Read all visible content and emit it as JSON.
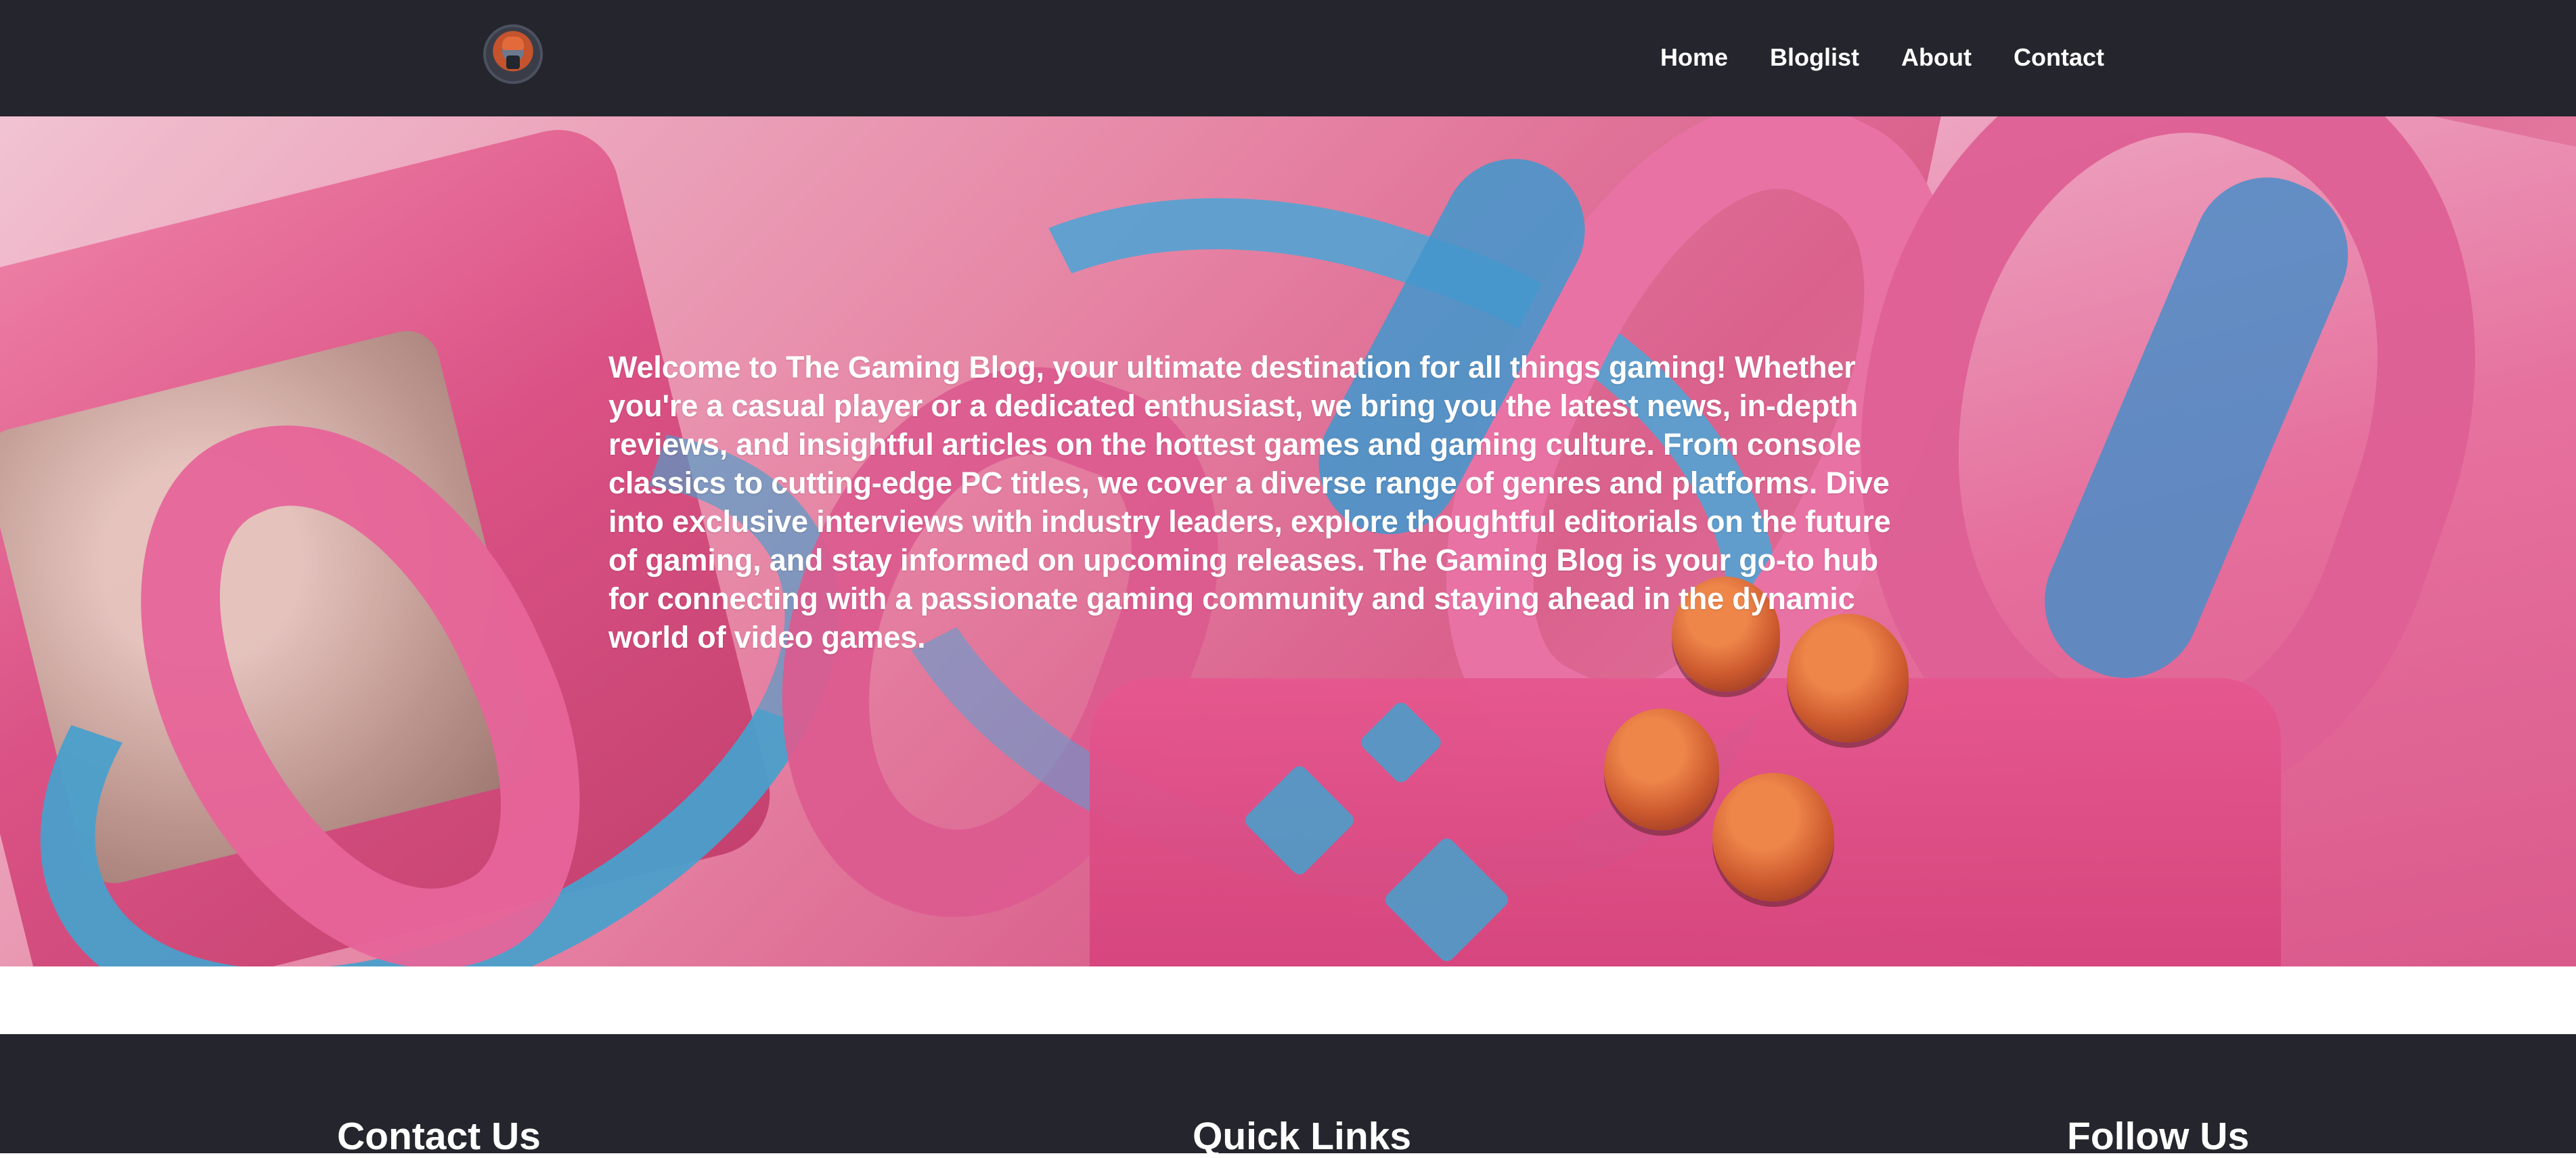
{
  "header": {
    "logo_icon": "gaming-mascot-logo-icon",
    "nav_items": [
      {
        "label": "Home"
      },
      {
        "label": "Bloglist"
      },
      {
        "label": "About"
      },
      {
        "label": "Contact"
      }
    ]
  },
  "hero": {
    "description": "Welcome to The Gaming Blog, your ultimate destination for all things gaming! Whether you're a casual player or a dedicated enthusiast, we bring you the latest news, in-depth reviews, and insightful articles on the hottest games and gaming culture. From console classics to cutting-edge PC titles, we cover a diverse range of genres and platforms. Dive into exclusive interviews with industry leaders, explore thoughtful editorials on the future of gaming, and stay informed on upcoming releases. The Gaming Blog is your go-to hub for connecting with a passionate gaming community and staying ahead in the dynamic world of video games."
  },
  "footer": {
    "contact_title": "Contact Us",
    "links_title": "Quick Links",
    "follow_title": "Follow Us"
  },
  "colors": {
    "header_bg": "#25252d",
    "footer_bg": "#25252d",
    "hero_pink": "#d9628d",
    "hero_blue": "#46aada",
    "hero_orange": "#cb5a27",
    "text": "#ffffff"
  }
}
